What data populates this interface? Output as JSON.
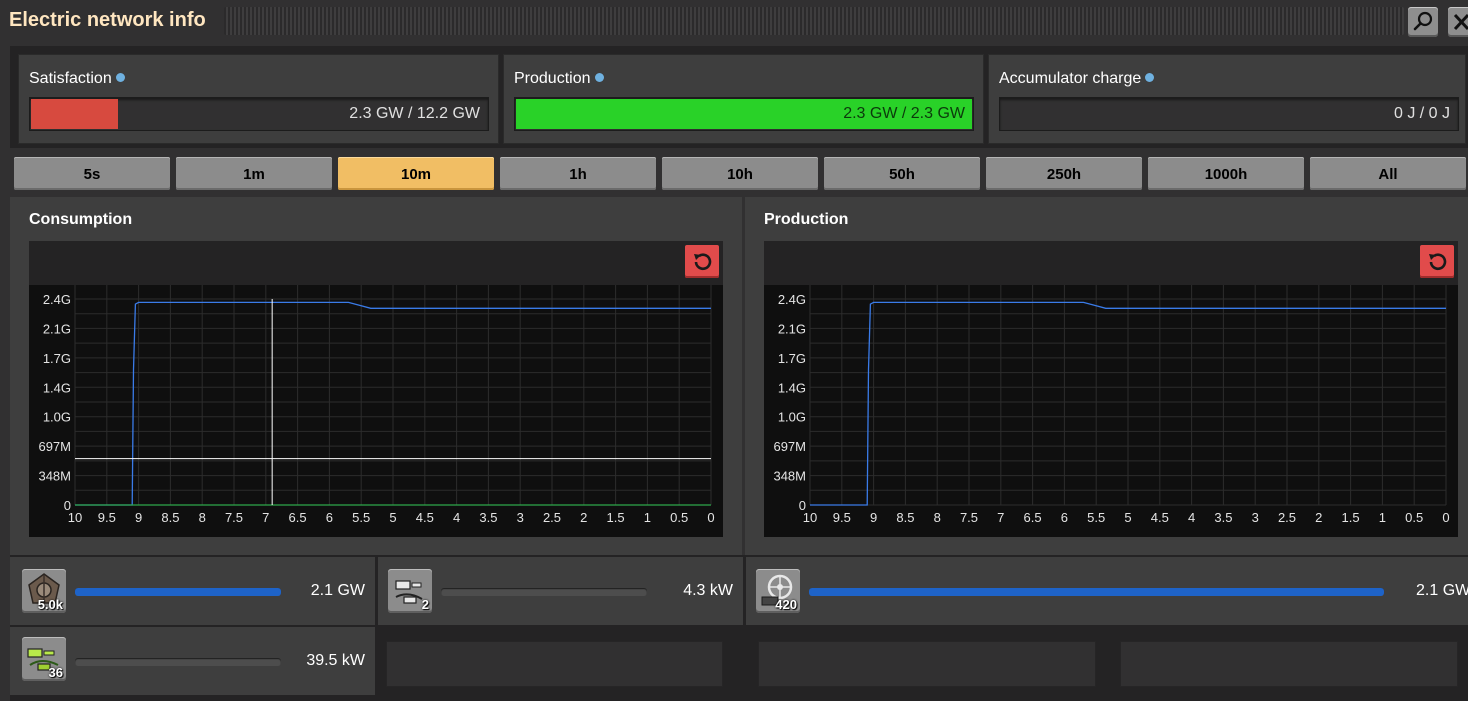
{
  "window": {
    "title": "Electric network info"
  },
  "titlebar": {
    "search_icon": "magnifier-icon",
    "close_icon": "close-x-icon"
  },
  "stats": {
    "satisfaction": {
      "label": "Satisfaction",
      "value": "2.3 GW / 12.2 GW",
      "fill_fraction": 0.19,
      "color": "#d74a3f"
    },
    "production": {
      "label": "Production",
      "value": "2.3 GW / 2.3 GW",
      "fill_fraction": 1.0,
      "color": "#29d228"
    },
    "accumulator": {
      "label": "Accumulator charge",
      "value": "0 J / 0 J",
      "fill_fraction": 0.0,
      "color": "#29d228"
    }
  },
  "time_buttons": [
    "5s",
    "1m",
    "10m",
    "1h",
    "10h",
    "50h",
    "250h",
    "1000h",
    "All"
  ],
  "selected_time": "10m",
  "consumption": {
    "title": "Consumption"
  },
  "production_graph": {
    "title": "Production"
  },
  "chart_data": [
    {
      "type": "line",
      "title": "Consumption",
      "x_ticks": [
        "10",
        "9.5",
        "9",
        "8.5",
        "8",
        "7.5",
        "7",
        "6.5",
        "6",
        "5.5",
        "5",
        "4.5",
        "4",
        "3.5",
        "3",
        "2.5",
        "2",
        "1.5",
        "1",
        "0.5",
        "0"
      ],
      "y_ticks": [
        "2.4G",
        "2.1G",
        "1.7G",
        "1.4G",
        "1.0G",
        "697M",
        "348M",
        "0"
      ],
      "xlim": [
        10,
        0
      ],
      "ylim": [
        0,
        2.44
      ],
      "grid": true,
      "series": [
        {
          "color": "#3a7be8",
          "x": [
            10,
            9.1,
            9.08,
            9.05,
            9.0,
            5.7,
            5.5,
            5.35,
            5.2,
            0
          ],
          "y": [
            0,
            0,
            1.6,
            2.38,
            2.4,
            2.4,
            2.36,
            2.33,
            2.33,
            2.33
          ]
        },
        {
          "color": "#2fa84a",
          "x": [
            10,
            0
          ],
          "y": [
            0,
            0
          ]
        }
      ],
      "cursor": {
        "x": 6.9,
        "y": 0.55
      }
    },
    {
      "type": "line",
      "title": "Production",
      "x_ticks": [
        "10",
        "9.5",
        "9",
        "8.5",
        "8",
        "7.5",
        "7",
        "6.5",
        "6",
        "5.5",
        "5",
        "4.5",
        "4",
        "3.5",
        "3",
        "2.5",
        "2",
        "1.5",
        "1",
        "0.5",
        "0"
      ],
      "y_ticks": [
        "2.4G",
        "2.1G",
        "1.7G",
        "1.4G",
        "1.0G",
        "697M",
        "348M",
        "0"
      ],
      "xlim": [
        10,
        0
      ],
      "ylim": [
        0,
        2.44
      ],
      "grid": true,
      "series": [
        {
          "color": "#3a7be8",
          "x": [
            10,
            9.1,
            9.08,
            9.05,
            9.0,
            5.7,
            5.5,
            5.35,
            5.2,
            0
          ],
          "y": [
            0,
            0,
            1.6,
            2.38,
            2.4,
            2.4,
            2.36,
            2.33,
            2.33,
            2.33
          ]
        }
      ]
    }
  ],
  "consumers": [
    {
      "icon": "electric-mining-drill-icon",
      "count": "5.0k",
      "value": "2.1 GW",
      "fill_fraction": 1.0
    },
    {
      "icon": "small-electric-pole-icon",
      "count": "2",
      "value": "4.3 kW",
      "fill_fraction": 0.0
    },
    {
      "icon": "medium-electric-pole-icon",
      "count": "36",
      "value": "39.5 kW",
      "fill_fraction": 0.0
    }
  ],
  "producers": [
    {
      "icon": "steam-engine-icon",
      "count": "420",
      "value": "2.1 GW",
      "fill_fraction": 1.0
    }
  ]
}
